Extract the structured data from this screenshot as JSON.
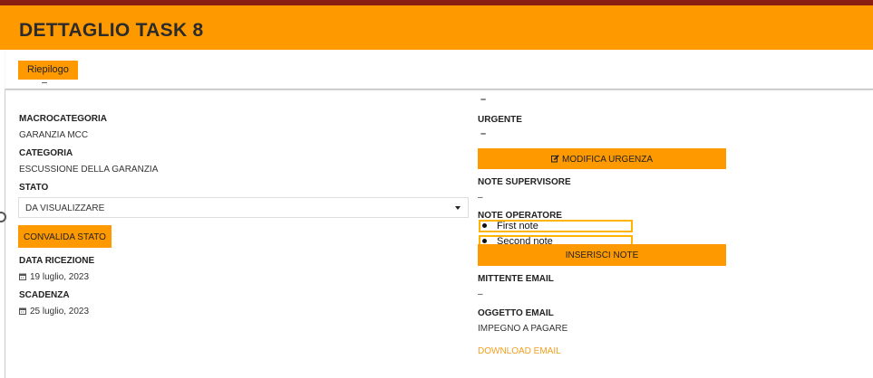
{
  "header": {
    "title": "DETTAGLIO TASK 8"
  },
  "tabs": {
    "riepilogo": "Riepilogo"
  },
  "left": {
    "macrocategoria_label": "MACROCATEGORIA",
    "macrocategoria_value": "GARANZIA MCC",
    "categoria_label": "CATEGORIA",
    "categoria_value": "ESCUSSIONE DELLA GARANZIA",
    "stato_label": "STATO",
    "stato_value": "DA VISUALIZZARE",
    "convalida_button": "CONVALIDA STATO",
    "data_ricezione_label": "DATA RICEZIONE",
    "data_ricezione_value": "19 luglio, 2023",
    "scadenza_label": "SCADENZA",
    "scadenza_value": "25 luglio, 2023",
    "calendar_icon": "calendar-icon"
  },
  "right": {
    "top_dash": "–",
    "urgente_label": "URGENTE",
    "urgente_value": "–",
    "modifica_urgenza_button": "MODIFICA URGENZA",
    "edit_icon": "edit-icon",
    "note_supervisore_label": "NOTE SUPERVISORE",
    "note_supervisore_value": "–",
    "note_operatore_label": "NOTE OPERATORE",
    "notes": [
      "First note",
      "Second note"
    ],
    "inserisci_note_button": "INSERISCI NOTE",
    "mittente_email_label": "MITTENTE EMAIL",
    "mittente_email_value": "–",
    "oggetto_email_label": "OGGETTO EMAIL",
    "oggetto_email_value": "IMPEGNO A PAGARE",
    "download_email_link": "DOWNLOAD EMAIL"
  },
  "colors": {
    "accent": "#ff9900",
    "topline": "#8a1d12",
    "note_border": "#ffb400",
    "link": "#f0a020"
  }
}
